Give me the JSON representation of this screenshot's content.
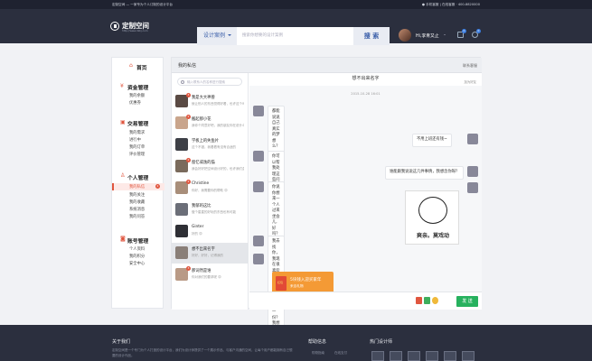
{
  "topbar": {
    "left": "定制空间 — 一家专为个人订制的设计平台",
    "right": "● 手机客服  |  在线客服  ·  400-8820000"
  },
  "header": {
    "logo_title": "定制空间",
    "logo_sub": "http://www.dzkj.com",
    "search_category": "设计案例",
    "search_placeholder": "搜索你想要的设计案例",
    "search_button": "搜 索",
    "user_name": "Hi,李青又止",
    "cart_count": "0",
    "msg_count": "0"
  },
  "sidebar": {
    "home": "首页",
    "sections": [
      {
        "title": "资金管理",
        "items": [
          "我的余额",
          "优惠券"
        ]
      },
      {
        "title": "交易管理",
        "items": [
          "我的需求",
          "进行中",
          "我的订单",
          "评价管理"
        ]
      },
      {
        "title": "个人管理",
        "items": [
          "我的私信",
          "我的关注",
          "我的收藏",
          "系统消息",
          "我的问答"
        ]
      },
      {
        "title": "账号管理",
        "items": [
          "个人资料",
          "我的积分",
          "安全中心"
        ]
      }
    ],
    "active_badge": "2"
  },
  "main": {
    "title": "我的私信",
    "right_action": "联系客服"
  },
  "search_box": {
    "placeholder": "输入联系人的名称进行搜索"
  },
  "contacts": [
    {
      "name": "我是大大神兽",
      "preview": "就让别人的东西觉得好看，也许这个可以满足你的要求吧",
      "badge": "3"
    },
    {
      "name": "搬起那小花",
      "preview": "我你个同意好吧，我的朋友你在说什么",
      "badge": "2"
    },
    {
      "name": "学板上的失鱼片",
      "preview": "这个不错，我看看有没有合适的",
      "badge": ""
    },
    {
      "name": "窗忆或逸的猫",
      "preview": "我会好好把空间设计好的，也许我们会有机会",
      "badge": "2"
    },
    {
      "name": "Christine",
      "preview": "你好，我需要你的帮助 😊",
      "badge": "2"
    },
    {
      "name": "我郁的这比",
      "preview": "做个星星的好玩的东西也有可能",
      "badge": ""
    },
    {
      "name": "Ginter",
      "preview": "好的 😊",
      "badge": ""
    },
    {
      "name": "想不出来名字",
      "preview": "好好，好好，记得我的",
      "badge": ""
    },
    {
      "name": "那词然是谁",
      "preview": "你对我们的要求呢 😊",
      "badge": "3"
    }
  ],
  "chat": {
    "title": "想不出来名字",
    "side_action": "加为好友",
    "timestamp": "2015-10-28 16:01",
    "messages": [
      {
        "side": "left",
        "text": "都能说说自己真实的梦想么？"
      },
      {
        "side": "right",
        "text": "不用上班还有钱~"
      },
      {
        "side": "left",
        "text": "你可以帮我处理这些问题吗？"
      },
      {
        "side": "right",
        "text": "谁能跟我说说这几件事情，我想念你呀？"
      },
      {
        "side": "left",
        "text": "你说你想来一个人过来坐会儿,",
        "text2": "好吗？😊"
      },
      {
        "side": "left",
        "text": "我去找你，我现在很喜欢你们，要不要让",
        "text2": "我给你做一份？我想要你的 5块 ！"
      }
    ],
    "meme_text": "爽亲。莫戏动",
    "red_packet": {
      "title": "5块钱入迎买家年",
      "sub": "来自礼物",
      "env": "红包"
    },
    "send": "发 送"
  },
  "footer": {
    "about_title": "关于我们",
    "about_text": "定制空间是一个专门为个人打造的设计平台，我们为设计师提供了一个展示作品、与客户沟通的空间，让每个用户都能拥有自己想要的设计作品。",
    "help_title": "帮助信息",
    "help_items": [
      "购物指南",
      "在线支付"
    ],
    "hot_title": "热门设计师"
  },
  "colors": {
    "accent": "#e0563f",
    "brand_dark": "#2b2f3e",
    "send_green": "#27b15e",
    "red_packet": "#f49a35"
  }
}
